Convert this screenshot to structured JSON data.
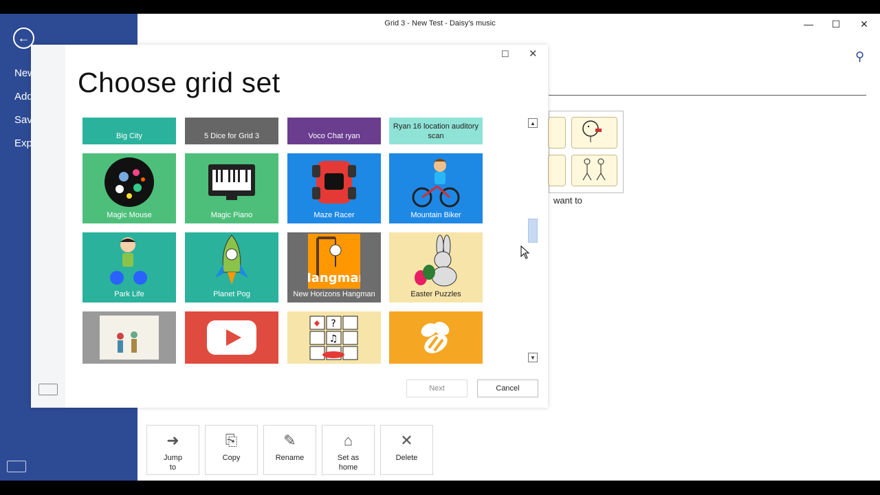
{
  "window": {
    "title": "Grid 3 - New Test - Daisy's music",
    "minimize": "—",
    "maximize": "☐",
    "close": "✕"
  },
  "sidebar": {
    "back_icon": "arrow-left-icon",
    "items": [
      {
        "label": "New"
      },
      {
        "label": "Add"
      },
      {
        "label": "Save"
      },
      {
        "label": "Exp"
      }
    ]
  },
  "background": {
    "caption": "want to",
    "search_icon": "search-icon"
  },
  "toolbar": {
    "buttons": [
      {
        "label": "Jump to",
        "icon": "arrow-right-icon",
        "glyph": "➜"
      },
      {
        "label": "Copy",
        "icon": "copy-icon",
        "glyph": "⎘"
      },
      {
        "label": "Rename",
        "icon": "rename-icon",
        "glyph": "✎"
      },
      {
        "label": "Set as home",
        "icon": "home-icon",
        "glyph": "⌂"
      },
      {
        "label": "Delete",
        "icon": "delete-icon",
        "glyph": "✕"
      }
    ]
  },
  "dialog": {
    "title": "Choose grid set",
    "maximize": "☐",
    "close": "✕",
    "next_label": "Next",
    "cancel_label": "Cancel",
    "scroll_up": "▲",
    "scroll_down": "▼",
    "tiles": [
      {
        "label": "Big City",
        "color": "#2ab29c"
      },
      {
        "label": "5 Dice for Grid 3",
        "color": "#666666"
      },
      {
        "label": "Voco Chat ryan",
        "color": "#6a3d8f"
      },
      {
        "label": "Ryan 16 location auditory scan",
        "color": "#8fe3d6",
        "dark": true
      },
      {
        "label": "Magic Mouse",
        "color": "#4dbf7a"
      },
      {
        "label": "Magic Piano",
        "color": "#4dbf7a"
      },
      {
        "label": "Maze Racer",
        "color": "#1e88e5"
      },
      {
        "label": "Mountain Biker",
        "color": "#1e88e5"
      },
      {
        "label": "Park Life",
        "color": "#2ab29c"
      },
      {
        "label": "Planet Pog",
        "color": "#2ab29c"
      },
      {
        "label": "New Horizons Hangman",
        "color": "#6d6d6d"
      },
      {
        "label": "Easter Puzzles",
        "color": "#f7e4a8",
        "dark": true
      },
      {
        "label": "",
        "color": "#9a9a9a"
      },
      {
        "label": "",
        "color": "#e04b3f"
      },
      {
        "label": "",
        "color": "#f7e4a8"
      },
      {
        "label": "",
        "color": "#f5a623"
      }
    ]
  }
}
